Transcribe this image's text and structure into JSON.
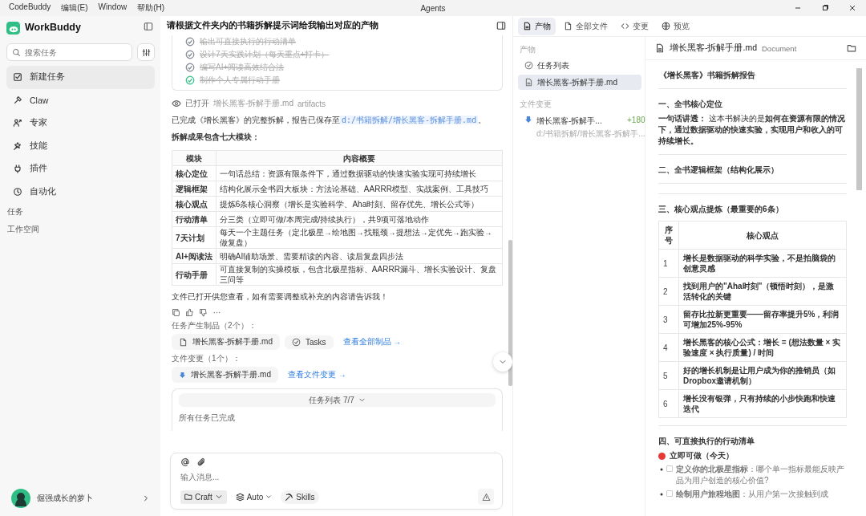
{
  "menu_bar": {
    "items": [
      "CodeBuddy",
      "编辑(E)",
      "Window",
      "帮助(H)"
    ],
    "title": "Agents"
  },
  "sidebar": {
    "app_name": "WorkBuddy",
    "search": {
      "placeholder": "搜索任务"
    },
    "nav": [
      {
        "label": "新建任务",
        "selected": true
      },
      {
        "label": "Claw",
        "selected": false
      },
      {
        "label": "专家",
        "selected": false
      },
      {
        "label": "技能",
        "selected": false
      },
      {
        "label": "插件",
        "selected": false
      },
      {
        "label": "自动化",
        "selected": false
      }
    ],
    "sections": [
      "任务",
      "工作空间"
    ],
    "user": {
      "name": "倔强成长的萝卜"
    }
  },
  "chat": {
    "title": "请根据文件夹内的书籍拆解提示词给我输出对应的产物",
    "todos": [
      {
        "text": "输出可直接执行的行动清单",
        "color": "#8a8f98"
      },
      {
        "text": "设计7天实践计划（每天重点+打卡）",
        "color": "#8a8f98"
      },
      {
        "text": "编写AI+阅读高效结合法",
        "color": "#8a8f98"
      },
      {
        "text": "制作个人专属行动手册",
        "color": "#3cc48f"
      }
    ],
    "opened": {
      "status": "已打开",
      "file": "增长黑客-拆解手册.md",
      "tag": "artifacts"
    },
    "summary": {
      "before": "已完成《增长黑客》的完整拆解，报告已保存至",
      "code": "d:/书籍拆解/增长黑客-拆解手册.md",
      "after": "。"
    },
    "table_intro": "拆解成果包含七大模块：",
    "table": {
      "columns": [
        "模块",
        "内容概要"
      ],
      "rows": [
        [
          "核心定位",
          "一句话总结：资源有限条件下，通过数据驱动的快速实验实现可持续增长"
        ],
        [
          "逻辑框架",
          "结构化展示全书四大板块：方法论基础、AARRR模型、实战案例、工具技巧"
        ],
        [
          "核心观点",
          "提炼6条核心洞察（增长是实验科学、Aha时刻、留存优先、增长公式等）"
        ],
        [
          "行动清单",
          "分三类（立即可做/本周完成/持续执行），共9项可落地动作"
        ],
        [
          "7天计划",
          "每天一个主题任务（定北极星→绘地图→找瓶颈→提想法→定优先→跑实验→做复盘）"
        ],
        [
          "AI+阅读法",
          "明确AI辅助场景、需要精读的内容、读后复盘四步法"
        ],
        [
          "行动手册",
          "可直接复制的实操模板，包含北极星指标、AARRR漏斗、增长实验设计、复盘三问等"
        ]
      ]
    },
    "closing": "文件已打开供您查看，如有需要调整或补充的内容请告诉我！",
    "artifacts": {
      "label": "任务产生制品（2个）：",
      "items": [
        {
          "kind": "file",
          "label": "增长黑客-拆解手册.md"
        },
        {
          "kind": "tasks",
          "label": "Tasks"
        }
      ],
      "link": "查看全部制品 →"
    },
    "changes": {
      "label": "文件变更（1个）：",
      "items": [
        {
          "kind": "change",
          "label": "增长黑客-拆解手册.md"
        }
      ],
      "link": "查看文件变更 →"
    },
    "task_list": {
      "title": "任务列表 7/7",
      "expanded": false,
      "status": "所有任务已完成"
    },
    "composer": {
      "placeholder": "输入消息...",
      "mode": "Craft",
      "model": "Auto",
      "skills": "Skills"
    }
  },
  "panel": {
    "tabs": [
      {
        "label": "产物",
        "selected": true
      },
      {
        "label": "全部文件",
        "selected": false
      },
      {
        "label": "变更",
        "selected": false
      },
      {
        "label": "预览",
        "selected": false
      }
    ],
    "artifacts_label": "产物",
    "artifacts": [
      {
        "kind": "tasks",
        "label": "任务列表",
        "selected": false
      },
      {
        "kind": "file",
        "label": "增长黑客-拆解手册.md",
        "selected": true
      }
    ],
    "changes_label": "文件变更",
    "changes": [
      {
        "name": "增长黑客-拆解手...",
        "added": "+180",
        "path": "d:/书籍拆解/增长黑客-拆解手..."
      }
    ],
    "document": {
      "filename": "增长黑客-拆解手册.md",
      "type": "Document",
      "blocks": [
        {
          "kind": "title",
          "text": "《增长黑客》书籍拆解报告"
        },
        {
          "kind": "rule"
        },
        {
          "kind": "heading",
          "text": "一、全书核心定位"
        },
        {
          "kind": "paragraph",
          "text": "**一句话讲透：** 这本书解决的是**如何在资源有限的情况下，通过数据驱动的快速实验，实现用户和收入的可持续增长。**"
        },
        {
          "kind": "rule"
        },
        {
          "kind": "heading",
          "text": "二、全书逻辑框架（结构化展示）"
        },
        {
          "kind": "rule"
        },
        {
          "kind": "rule"
        },
        {
          "kind": "heading",
          "text": "三、核心观点提炼（最重要的6条）"
        },
        {
          "kind": "table",
          "columns": [
            "序号",
            "核心观点"
          ],
          "rows": [
            [
              "1",
              "增长是数据驱动的科学实验，不是拍脑袋的创意灵感"
            ],
            [
              "2",
              "找到用户的\"Aha时刻\"（顿悟时刻），是激活转化的关键"
            ],
            [
              "3",
              "留存比拉新更重要——留存率提升5%，利润可增加25%-95%"
            ],
            [
              "4",
              "增长黑客的核心公式：增长 = (想法数量 × 实验速度 × 执行质量) / 时间"
            ],
            [
              "5",
              "好的增长机制是让用户成为你的推销员（如Dropbox邀请机制）"
            ],
            [
              "6",
              "增长没有银弹，只有持续的小步快跑和快速迭代"
            ]
          ]
        },
        {
          "kind": "rule"
        },
        {
          "kind": "heading",
          "text": "四、可直接执行的行动清单"
        },
        {
          "kind": "priority",
          "color": "#e53935",
          "text": "立即可做（今天）"
        },
        {
          "kind": "checklist",
          "items": [
            {
              "checked": false,
              "text": "**定义你的北极星指标**：哪个单一指标最能反映产品为用户创造的核心价值?"
            },
            {
              "checked": false,
              "text": "**绘制用户旅程地图**：从用户第一次接触到成"
            }
          ]
        }
      ]
    }
  }
}
